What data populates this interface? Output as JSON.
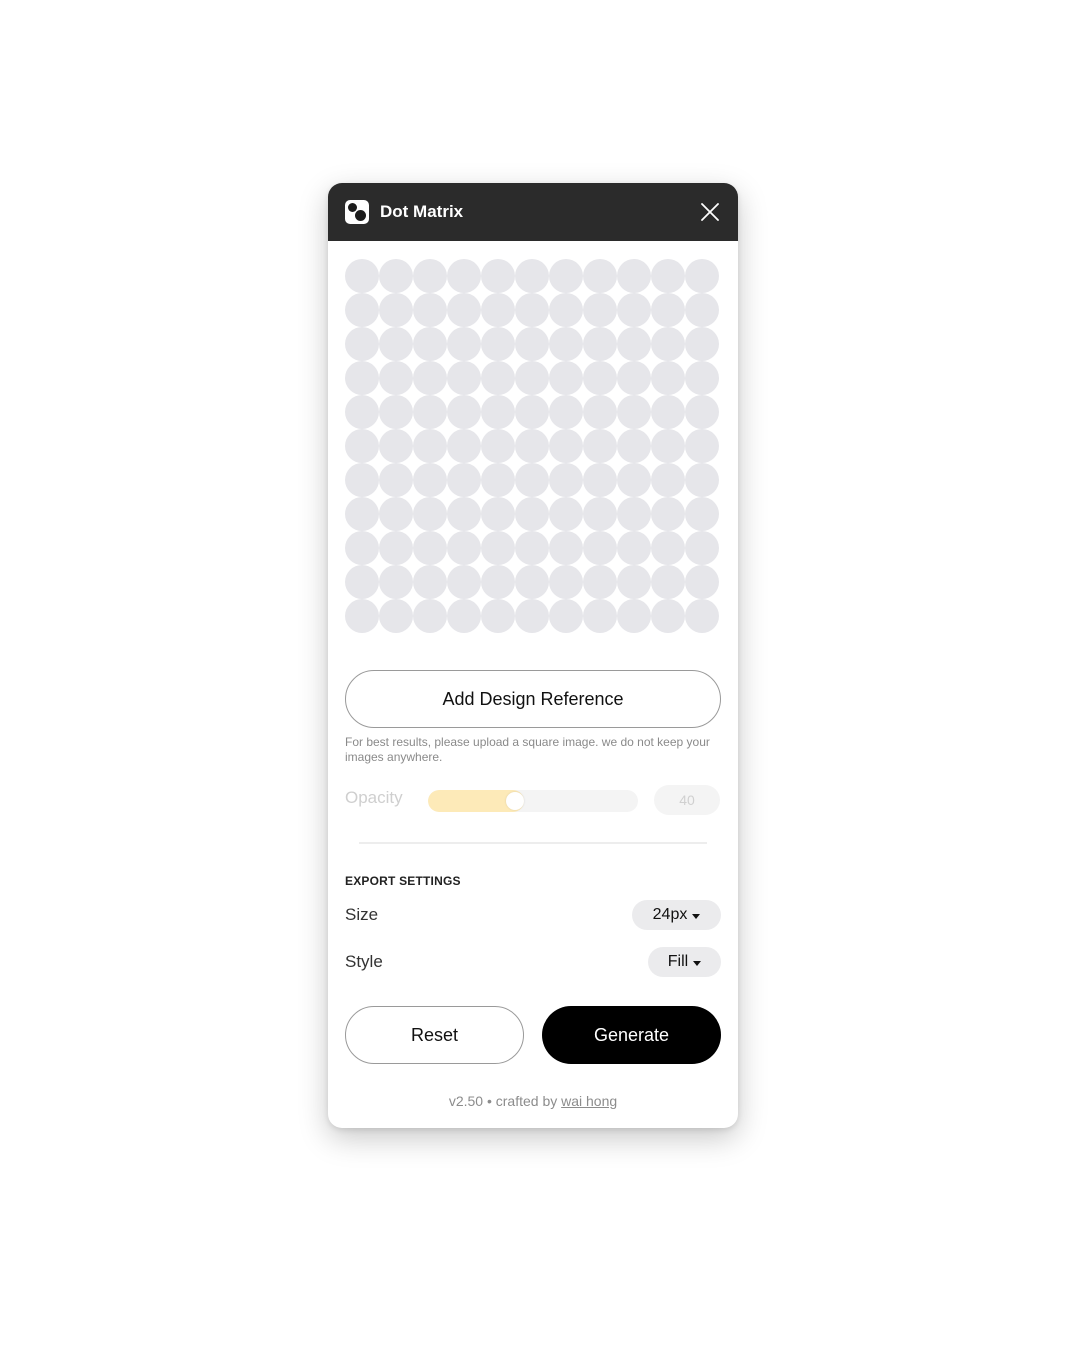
{
  "window": {
    "title": "Dot Matrix",
    "icon": "dot-matrix-logo-icon",
    "close_icon": "close-icon"
  },
  "preview": {
    "rows": 11,
    "cols": 11,
    "dot_color": "#e6e6ea"
  },
  "reference": {
    "button_label": "Add Design Reference",
    "hint": "For best results, please upload a square image. we do not keep your images anywhere."
  },
  "opacity": {
    "label": "Opacity",
    "value": "40",
    "level_percent": 40,
    "fill_color": "#fdeab8"
  },
  "export": {
    "heading": "EXPORT SETTINGS",
    "size_label": "Size",
    "size_value": "24px",
    "style_label": "Style",
    "style_value": "Fill"
  },
  "actions": {
    "reset_label": "Reset",
    "generate_label": "Generate"
  },
  "footer": {
    "version_text": "v2.50 • crafted by",
    "author_link": "wai hong"
  },
  "colors": {
    "titlebar": "#2b2b2b",
    "primary_button": "#000000"
  }
}
